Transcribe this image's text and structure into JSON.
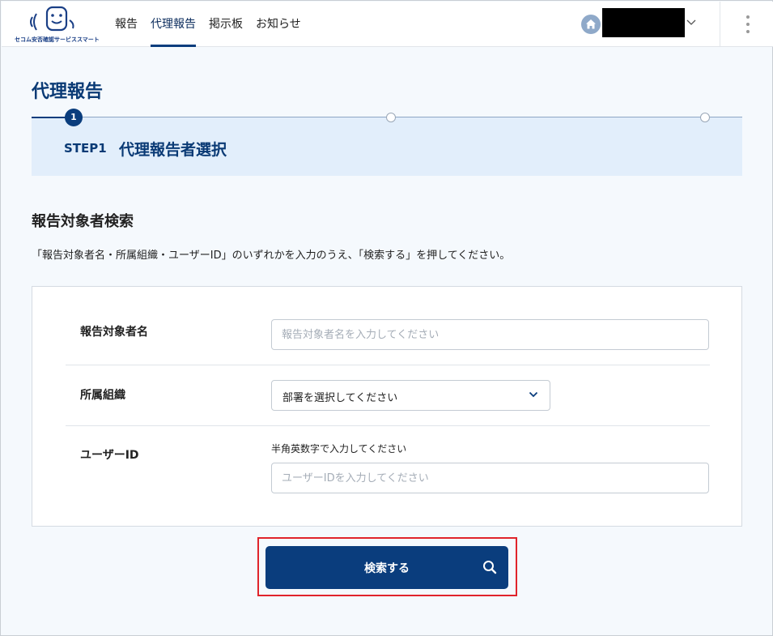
{
  "header": {
    "logo_text": "セコム安否確認サービススマート",
    "nav": [
      {
        "label": "報告",
        "active": false
      },
      {
        "label": "代理報告",
        "active": true
      },
      {
        "label": "掲示板",
        "active": false
      },
      {
        "label": "お知らせ",
        "active": false
      }
    ],
    "user_icon": "home-icon",
    "menu_icon": "kebab-menu-icon"
  },
  "page": {
    "title": "代理報告"
  },
  "stepper": {
    "current_step_number": "1",
    "step_label": "STEP1",
    "step_title": "代理報告者選択",
    "total_steps": 3,
    "current_step": 1
  },
  "search": {
    "section_title": "報告対象者検索",
    "instruction": "「報告対象者名・所属組織・ユーザーID」のいずれかを入力のうえ、「検索する」を押してください。",
    "fields": {
      "name": {
        "label": "報告対象者名",
        "value": "",
        "placeholder": "報告対象者名を入力してください"
      },
      "organization": {
        "label": "所属組織",
        "value": "部署を選択してください"
      },
      "user_id": {
        "label": "ユーザーID",
        "hint": "半角英数字で入力してください",
        "value": "",
        "placeholder": "ユーザーIDを入力してください"
      }
    },
    "button_label": "検索する"
  },
  "colors": {
    "primary": "#0a3d7d",
    "banner": "#e2eefb",
    "highlight": "#e0242b",
    "background": "#f5f9fd"
  }
}
